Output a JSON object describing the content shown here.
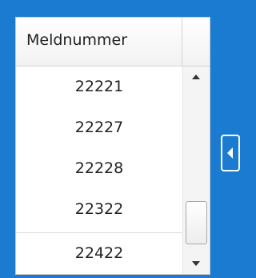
{
  "grid": {
    "column_header": "Meldnummer",
    "rows": [
      "22221",
      "22227",
      "22228",
      "22322",
      "22422"
    ]
  },
  "icons": {
    "scroll_up": "triangle-up",
    "scroll_down": "triangle-down",
    "collapse_panel": "triangle-left"
  },
  "colors": {
    "background": "#1a7bd1",
    "panel": "#ffffff",
    "text": "#222222"
  }
}
